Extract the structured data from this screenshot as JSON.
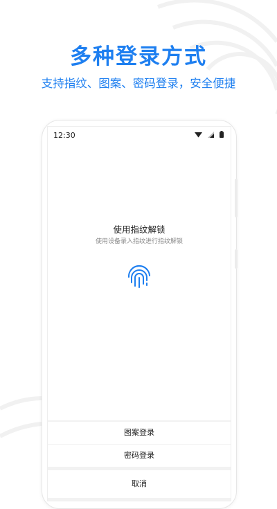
{
  "promo": {
    "headline": "多种登录方式",
    "subline": "支持指纹、图案、密码登录，安全便捷"
  },
  "status_bar": {
    "time": "12:30",
    "icons": [
      "wifi-icon",
      "signal-icon",
      "battery-icon"
    ]
  },
  "lock_screen": {
    "title": "使用指纹解锁",
    "hint": "使用设备录入指纹进行指纹解锁",
    "icon": "fingerprint-icon"
  },
  "options": {
    "pattern_login": "图案登录",
    "password_login": "密码登录",
    "cancel": "取消"
  },
  "colors": {
    "accent": "#1e7ff0"
  }
}
